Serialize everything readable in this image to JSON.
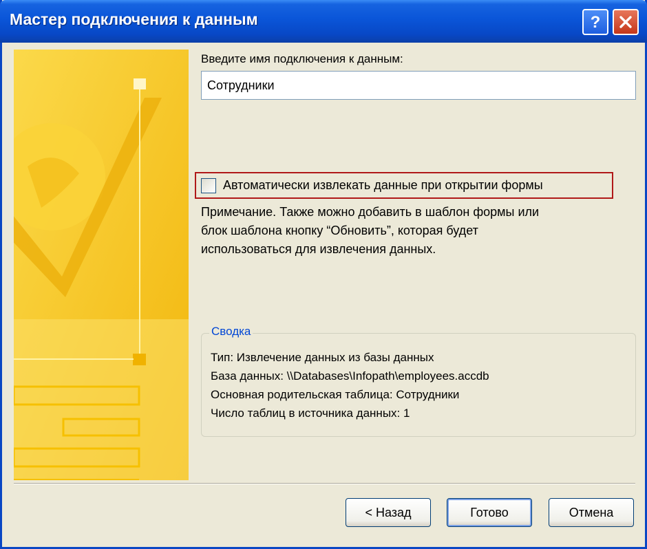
{
  "window": {
    "title": "Мастер подключения к данным",
    "help_label": "?",
    "close_label": "✕"
  },
  "form": {
    "name_label": "Введите имя подключения к данным:",
    "name_value": "Сотрудники",
    "auto_retrieve_label": "Автоматически извлекать данные при открытии формы",
    "auto_retrieve_checked": false,
    "note_line1": "Примечание. Также можно добавить в шаблон формы или",
    "note_line2": "блок шаблона кнопку “Обновить”, которая будет",
    "note_line3": "использоваться для извлечения данных."
  },
  "summary": {
    "title": "Сводка",
    "lines": [
      "Тип: Извлечение данных из базы данных",
      "База данных: \\\\Databases\\Infopath\\employees.accdb",
      "Основная родительская таблица: Сотрудники",
      "Число таблиц в источника данных: 1"
    ]
  },
  "buttons": {
    "back": "< Назад",
    "finish": "Готово",
    "cancel": "Отмена"
  },
  "colors": {
    "titlebar": "#0a55d8",
    "side_panel": "#f7c516",
    "highlight_border": "#b01818",
    "summary_title": "#0046d5"
  }
}
